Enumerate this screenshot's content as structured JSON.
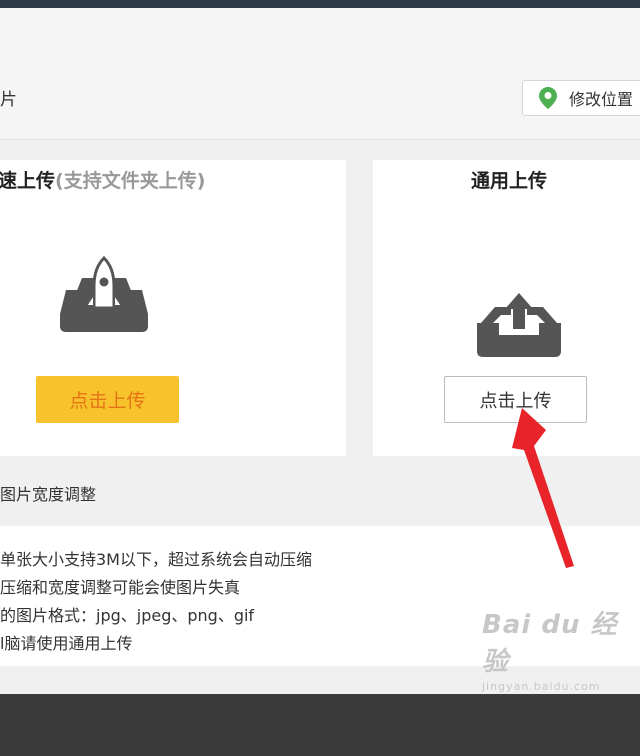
{
  "header": {
    "crumb_text": "片",
    "location_button": "修改位置"
  },
  "fast_upload": {
    "title": "速上传",
    "subtitle": "(支持文件夹上传)",
    "button": "点击上传"
  },
  "general_upload": {
    "title": "通用上传",
    "button": "点击上传"
  },
  "options": {
    "width_adjust": "图片宽度调整"
  },
  "notes": [
    "单张大小支持3M以下，超过系统会自动压缩",
    "压缩和宽度调整可能会使图片失真",
    "的图片格式：jpg、jpeg、png、gif",
    "l脑请使用通用上传"
  ],
  "watermark": {
    "main": "Bai du 经验",
    "sub": "jingyan.baidu.com"
  },
  "colors": {
    "accent_yellow": "#f8c22d",
    "yellow_button_text": "#e57417",
    "location_pin": "#4caf50",
    "annotation_arrow": "#e8242a",
    "footer": "#3a3a3a"
  }
}
